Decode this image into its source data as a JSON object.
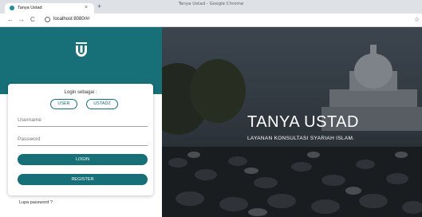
{
  "browser": {
    "window_title": "Tanya Ustad - Google Chrome",
    "tab_title": "Tanya Ustad",
    "tab_close": "×",
    "new_tab": "+",
    "url": "localhost:8080/#/",
    "icons": [
      "back-arrow-icon",
      "forward-arrow-icon",
      "reload-icon",
      "site-info-icon",
      "star-icon"
    ]
  },
  "login": {
    "prompt": "Login sebagai :",
    "roles": [
      "USER",
      "USTADZ"
    ],
    "username_placeholder": "Username",
    "password_placeholder": "Password",
    "login_button": "LOGIN",
    "register_button": "REGISTER",
    "forgot_password": "Lupa password ?"
  },
  "hero": {
    "title": "TANYA USTAD",
    "subtitle": "LAYANAN KONSULTASI SYARIAH ISLAM."
  },
  "colors": {
    "primary": "#176f78",
    "chrome": "#dee1e6"
  }
}
